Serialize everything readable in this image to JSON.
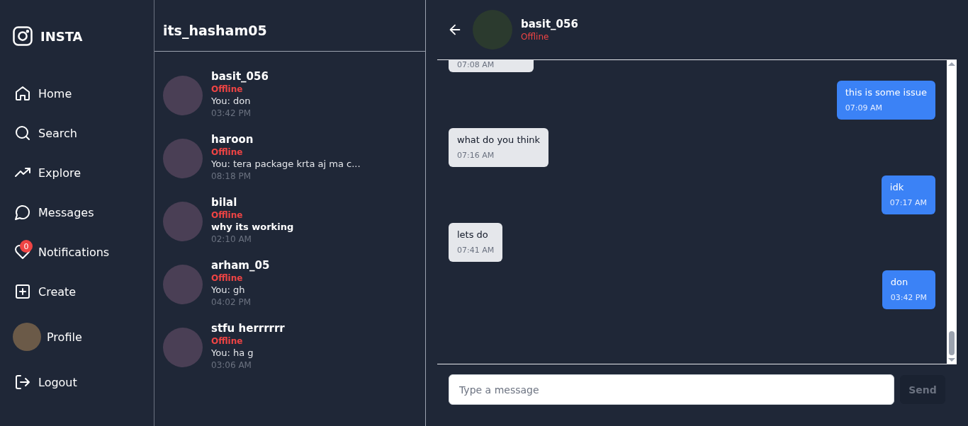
{
  "sidebar": {
    "logo": "INSTA",
    "items": [
      {
        "kind": "nav",
        "label": "Home"
      },
      {
        "kind": "nav",
        "label": "Search"
      },
      {
        "kind": "nav",
        "label": "Explore"
      },
      {
        "kind": "nav",
        "label": "Messages"
      },
      {
        "kind": "nav",
        "label": "Notifications",
        "badge": "0"
      },
      {
        "kind": "nav",
        "label": "Create"
      },
      {
        "kind": "profile",
        "label": "Profile"
      },
      {
        "kind": "nav",
        "label": "Logout"
      }
    ]
  },
  "conversations": {
    "title": "its_hasham05",
    "items": [
      {
        "name": "basit_056",
        "status": "Offline",
        "preview": "You: don",
        "time": "03:42 PM",
        "unread": false
      },
      {
        "name": "haroon",
        "status": "Offline",
        "preview": "You: tera package krta aj ma c...",
        "time": "08:18 PM",
        "unread": false
      },
      {
        "name": "bilal",
        "status": "Offline",
        "preview": "why its working",
        "time": "02:10 AM",
        "unread": true
      },
      {
        "name": "arham_05",
        "status": "Offline",
        "preview": "You: gh",
        "time": "04:02 PM",
        "unread": false
      },
      {
        "name": "stfu herrrrrr",
        "status": "Offline",
        "preview": "You: ha g",
        "time": "03:06 AM",
        "unread": false
      }
    ]
  },
  "chat": {
    "name": "basit_056",
    "status": "Offline",
    "messages": [
      {
        "kind": "received",
        "time": "07:08 AM"
      },
      {
        "kind": "sent",
        "text": "this is some issue",
        "time": "07:09 AM"
      },
      {
        "kind": "received",
        "text": "what do you think",
        "time": "07:16 AM"
      },
      {
        "kind": "sent",
        "text": "idk",
        "time": "07:17 AM"
      },
      {
        "kind": "received",
        "text": "lets do",
        "time": "07:41 AM"
      },
      {
        "kind": "sent",
        "text": "don",
        "time": "03:42 PM"
      }
    ],
    "input": {
      "placeholder": "Type a message"
    },
    "send_button": "Send"
  }
}
